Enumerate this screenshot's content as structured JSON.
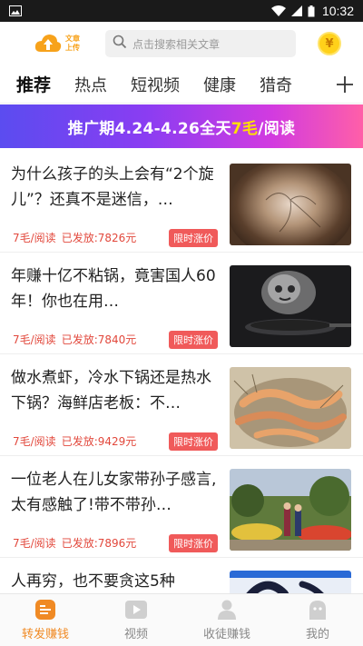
{
  "status_bar": {
    "time": "10:32"
  },
  "header": {
    "logo_text": "文章上传",
    "search_placeholder": "点击搜索相关文章",
    "coin_symbol": "¥"
  },
  "tabs": [
    {
      "label": "推荐",
      "active": true
    },
    {
      "label": "热点",
      "active": false
    },
    {
      "label": "短视频",
      "active": false
    },
    {
      "label": "健康",
      "active": false
    },
    {
      "label": "猎奇",
      "active": false
    }
  ],
  "promo": {
    "prefix": "推广期4.24-4.26全天",
    "highlight": "7毛",
    "suffix": "/阅读"
  },
  "articles": [
    {
      "title": "为什么孩子的头上会有“2个旋儿”？还真不是迷信，…",
      "price": "7毛/阅读",
      "issued": "已发放:7826元",
      "badge": "限时涨价",
      "thumb_icon": "hair-whorl-image"
    },
    {
      "title": "年赚十亿不粘锅，竟害国人60年！你也在用…",
      "price": "7毛/阅读",
      "issued": "已发放:7840元",
      "badge": "限时涨价",
      "thumb_icon": "smoking-pan-image"
    },
    {
      "title": "做水煮虾，冷水下锅还是热水下锅？海鲜店老板：不…",
      "price": "7毛/阅读",
      "issued": "已发放:9429元",
      "badge": "限时涨价",
      "thumb_icon": "shrimp-image"
    },
    {
      "title": "一位老人在儿女家带孙子感言,太有感触了!带不带孙…",
      "price": "7毛/阅读",
      "issued": "已发放:7896元",
      "badge": "限时涨价",
      "thumb_icon": "garden-couple-image"
    },
    {
      "title": "人再穷，也不要贪这5种",
      "price": "",
      "issued": "",
      "badge": "",
      "thumb_icon": "ink-painting-image"
    }
  ],
  "bottom_nav": [
    {
      "label": "转发赚钱",
      "icon": "share-earn-icon",
      "active": true
    },
    {
      "label": "视频",
      "icon": "video-icon",
      "active": false
    },
    {
      "label": "收徒赚钱",
      "icon": "user-icon",
      "active": false
    },
    {
      "label": "我的",
      "icon": "profile-icon",
      "active": false
    }
  ],
  "colors": {
    "accent": "#f08a24",
    "price_red": "#e2483c",
    "badge_red": "#f05a5a",
    "coin": "#ffd11a"
  }
}
